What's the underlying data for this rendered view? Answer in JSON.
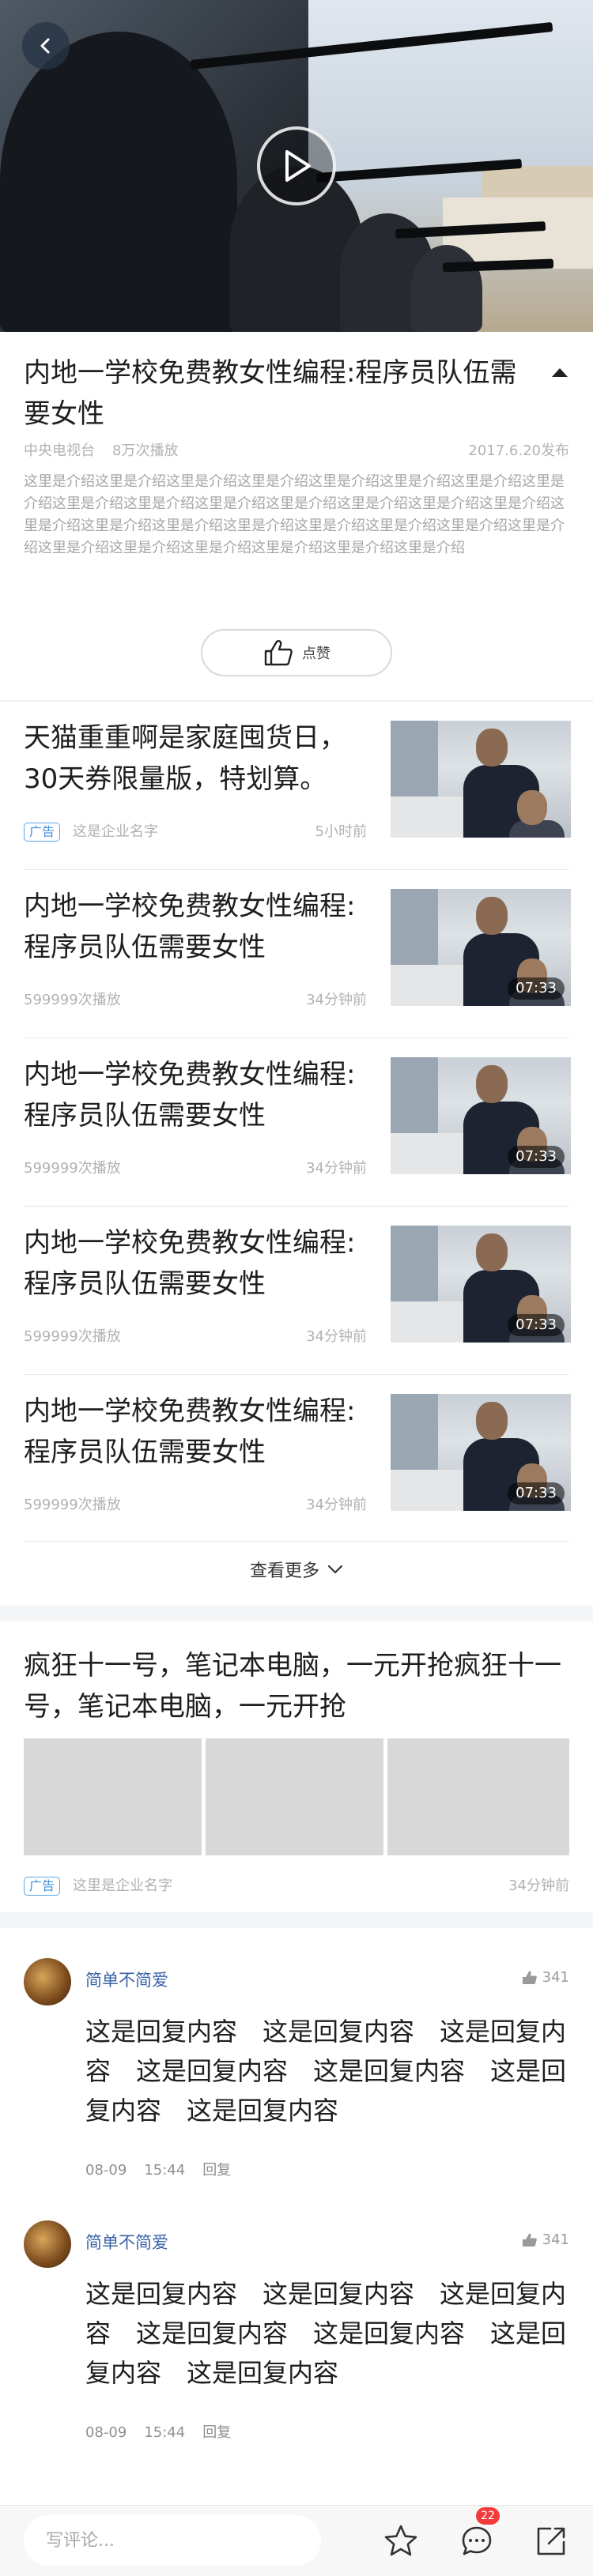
{
  "video": {
    "back_icon": "chevron-left-icon",
    "play_icon": "play-icon"
  },
  "article": {
    "title": "内地一学校免费教女性编程:程序员队伍需要女性",
    "source": "中央电视台",
    "plays": "8万次播放",
    "date": "2017.6.20发布",
    "description": "这里是介绍这里是介绍这里是介绍这里是介绍这里是介绍这里是介绍这里是介绍这里是介绍这里是介绍这里是介绍这里是介绍这里是介绍这里是介绍这里是介绍这里是介绍这里是介绍这里是介绍这里是介绍这里是介绍这里是介绍这里是介绍这里是介绍这里是介绍这里是介绍这里是介绍这里是介绍这里是介绍这里是介绍这里是介绍",
    "like_label": "点赞"
  },
  "feed": [
    {
      "title": "天猫重重啊是家庭囤货日，30天券限量版，特划算。",
      "ad_badge": "广告",
      "left": "这是企业名字",
      "right": "5小时前",
      "duration": ""
    },
    {
      "title": "内地一学校免费教女性编程:程序员队伍需要女性",
      "ad_badge": "",
      "left": "599999次播放",
      "right": "34分钟前",
      "duration": "07:33"
    },
    {
      "title": "内地一学校免费教女性编程:程序员队伍需要女性",
      "ad_badge": "",
      "left": "599999次播放",
      "right": "34分钟前",
      "duration": "07:33"
    },
    {
      "title": "内地一学校免费教女性编程:程序员队伍需要女性",
      "ad_badge": "",
      "left": "599999次播放",
      "right": "34分钟前",
      "duration": "07:33"
    },
    {
      "title": "内地一学校免费教女性编程:程序员队伍需要女性",
      "ad_badge": "",
      "left": "599999次播放",
      "right": "34分钟前",
      "duration": "07:33"
    }
  ],
  "more_label": "查看更多",
  "ad": {
    "title": "疯狂十一号，笔记本电脑，一元开抢疯狂十一号，笔记本电脑，一元开抢",
    "badge": "广告",
    "company": "这里是企业名字",
    "time": "34分钟前"
  },
  "comments": [
    {
      "user": "简单不简爱",
      "likes": "341",
      "text": "这是回复内容　这是回复内容　这是回复内容　这是回复内容　这是回复内容　这是回复内容　这是回复内容",
      "date": "08-09",
      "time": "15:44",
      "reply": "回复"
    },
    {
      "user": "简单不简爱",
      "likes": "341",
      "text": "这是回复内容　这是回复内容　这是回复内容　这是回复内容　这是回复内容　这是回复内容　这是回复内容",
      "date": "08-09",
      "time": "15:44",
      "reply": "回复"
    }
  ],
  "bottombar": {
    "placeholder": "写评论...",
    "comment_count": "22",
    "icons": [
      "star-icon",
      "comment-icon",
      "share-icon"
    ]
  },
  "colors": {
    "link_blue": "#3b63a8",
    "ad_blue": "#3f8fdc",
    "badge_red": "#f23b3b"
  }
}
